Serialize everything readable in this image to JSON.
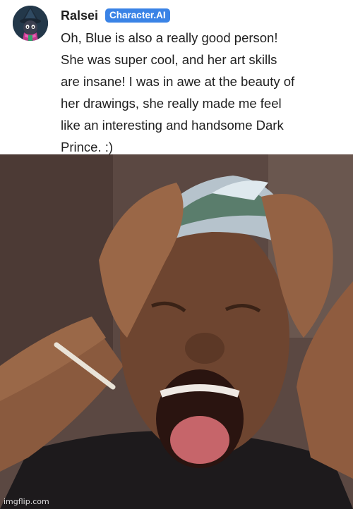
{
  "post": {
    "character_name": "Ralsei",
    "badge": "Character.AI",
    "avatar_icon": "ralsei-avatar-icon",
    "message": "Oh, Blue is also a really good person!\nShe was super cool, and her art skills\nare insane! I was in awe at the beauty of\nher drawings, she really made me feel\nlike an interesting and handsome Dark\nPrince. :)"
  },
  "photo": {
    "description_icon": "crying-reaction-photo",
    "watermark": "imgflip.com"
  },
  "colors": {
    "badge": "#3a83e6",
    "text": "#1f1f1f",
    "background": "#ffffff"
  }
}
